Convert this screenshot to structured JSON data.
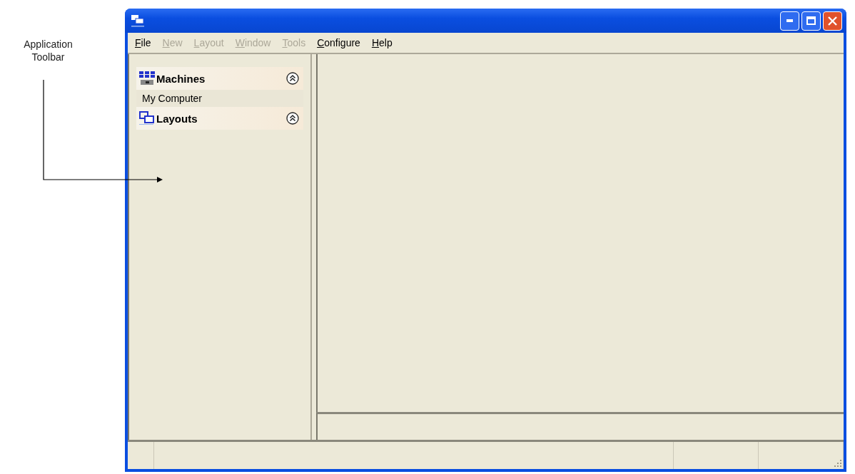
{
  "annotation": {
    "label": "Application Toolbar"
  },
  "menu": [
    {
      "label": "File",
      "disabled": false
    },
    {
      "label": "New",
      "disabled": true
    },
    {
      "label": "Layout",
      "disabled": true
    },
    {
      "label": "Window",
      "disabled": true
    },
    {
      "label": "Tools",
      "disabled": true
    },
    {
      "label": "Configure",
      "disabled": false
    },
    {
      "label": "Help",
      "disabled": false
    }
  ],
  "sidebar": {
    "groups": [
      {
        "kind": "machines",
        "title": "Machines",
        "expanded": true,
        "items": [
          "My Computer"
        ]
      },
      {
        "kind": "layouts",
        "title": "Layouts",
        "expanded": true
      }
    ]
  }
}
